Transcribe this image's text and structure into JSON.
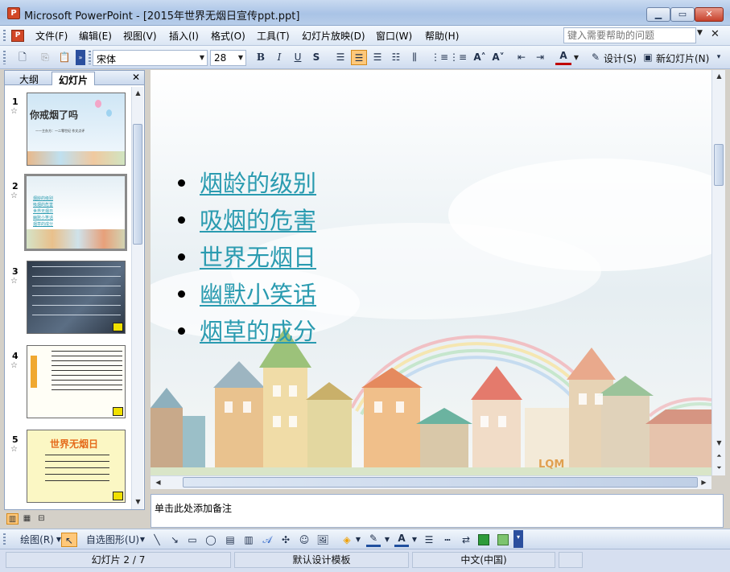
{
  "window": {
    "title": "Microsoft PowerPoint - [2015年世界无烟日宣传ppt.ppt]",
    "app_icon": "P",
    "minimize_icon": "minimize-icon",
    "maximize_icon": "maximize-icon",
    "close_icon": "close-icon"
  },
  "menu": {
    "items": [
      "文件(F)",
      "编辑(E)",
      "视图(V)",
      "插入(I)",
      "格式(O)",
      "工具(T)",
      "幻灯片放映(D)",
      "窗口(W)",
      "帮助(H)"
    ],
    "help_placeholder": "键入需要帮助的问题"
  },
  "toolbar": {
    "font": "宋体",
    "size": "28",
    "design_label": "设计(S)",
    "new_slide_label": "新幻灯片(N)"
  },
  "left_pane": {
    "tabs": [
      "大纲",
      "幻灯片"
    ],
    "selected_tab": "幻灯片",
    "slides": [
      {
        "num": "1",
        "thumb_title": "你戒烟了吗",
        "thumb_sub": "——主办方：一二零世纪 作文点评"
      },
      {
        "num": "2",
        "thumb_lines": [
          "烟龄的级别",
          "吸烟的危害",
          "世界无烟日",
          "幽默小笑话",
          "烟草的成分"
        ]
      },
      {
        "num": "3"
      },
      {
        "num": "4"
      },
      {
        "num": "5",
        "thumb_title": "世界无烟日"
      }
    ],
    "selected_slide": "2"
  },
  "slide": {
    "bullets": [
      "烟龄的级别",
      "吸烟的危害",
      "世界无烟日",
      "幽默小笑话",
      "烟草的成分"
    ],
    "watermark": "LQM",
    "link_color": "#2a9bb0"
  },
  "notes": {
    "placeholder": "单击此处添加备注"
  },
  "drawbar": {
    "draw_label": "绘图(R)",
    "autoshape_label": "自选图形(U)"
  },
  "status": {
    "slide_info": "幻灯片 2 / 7",
    "template": "默认设计模板",
    "language": "中文(中国)"
  }
}
